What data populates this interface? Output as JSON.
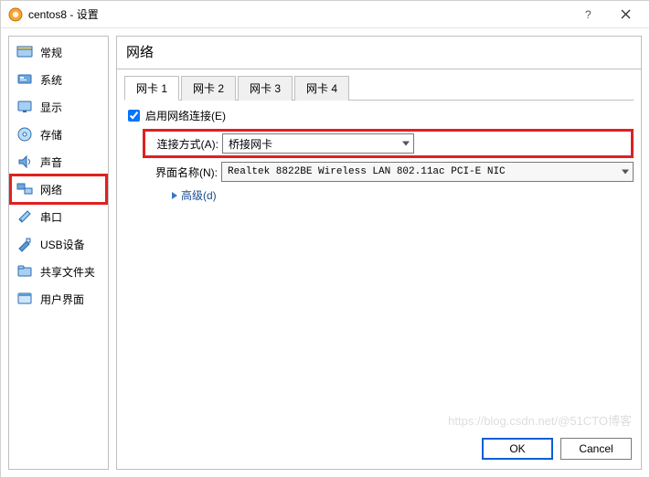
{
  "titlebar": {
    "title": "centos8 - 设置"
  },
  "sidebar": {
    "items": [
      {
        "label": "常规"
      },
      {
        "label": "系统"
      },
      {
        "label": "显示"
      },
      {
        "label": "存储"
      },
      {
        "label": "声音"
      },
      {
        "label": "网络"
      },
      {
        "label": "串口"
      },
      {
        "label": "USB设备"
      },
      {
        "label": "共享文件夹"
      },
      {
        "label": "用户界面"
      }
    ]
  },
  "main": {
    "heading": "网络",
    "tabs": [
      "网卡 1",
      "网卡 2",
      "网卡 3",
      "网卡 4"
    ],
    "enable_label": "启用网络连接(E)",
    "attach_label": "连接方式(A):",
    "attach_value": "桥接网卡",
    "name_label": "界面名称(N):",
    "name_value": "Realtek 8822BE Wireless LAN 802.11ac PCI-E NIC",
    "advanced_label": "高级(d)"
  },
  "footer": {
    "ok": "OK",
    "cancel": "Cancel"
  },
  "watermark": "https://blog.csdn.net/@51CTO博客"
}
